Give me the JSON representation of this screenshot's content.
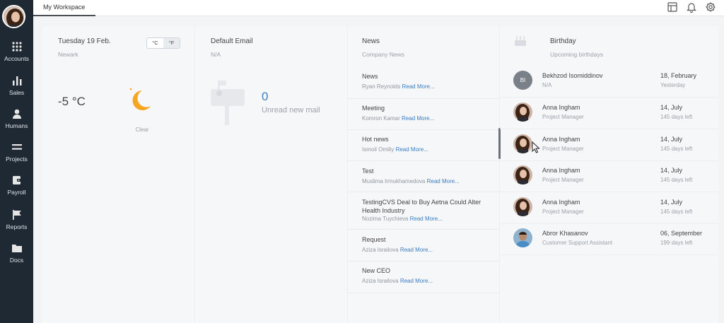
{
  "sidebar": {
    "items": [
      {
        "label": "Accounts",
        "icon": "grid-icon"
      },
      {
        "label": "Sales",
        "icon": "bar-chart-icon"
      },
      {
        "label": "Humans",
        "icon": "person-icon"
      },
      {
        "label": "Projects",
        "icon": "list-icon"
      },
      {
        "label": "Payroll",
        "icon": "wallet-icon"
      },
      {
        "label": "Reports",
        "icon": "flag-icon"
      },
      {
        "label": "Docs",
        "icon": "folder-icon"
      }
    ]
  },
  "topbar": {
    "tab_label": "My Workspace",
    "icons": [
      "layout-icon",
      "bell-icon",
      "gear-icon"
    ]
  },
  "weather": {
    "date": "Tuesday 19 Feb.",
    "city": "Newark",
    "unit_c": "°C",
    "unit_f": "°F",
    "temperature": "-5 °C",
    "condition": "Clear",
    "icon": "moon-icon"
  },
  "email": {
    "title": "Default Email",
    "address": "N/A",
    "unread_count": "0",
    "unread_label": "Unread new mail",
    "icon": "mailbox-icon"
  },
  "news": {
    "title": "News",
    "subtitle": "Company News",
    "read_more": "Read More...",
    "items": [
      {
        "title": "News",
        "author": "Ryan Reynolds"
      },
      {
        "title": "Meeting",
        "author": "Komron Kamar"
      },
      {
        "title": "Hot news",
        "author": "Ismoil Omiliy"
      },
      {
        "title": "Test",
        "author": "Muslima Irmukhamedova"
      },
      {
        "title": "TestingCVS Deal to Buy Aetna Could Alter Health Industry",
        "author": "Nozima Tuychieva"
      },
      {
        "title": "Request",
        "author": "Aziza Israilova"
      },
      {
        "title": "New CEO",
        "author": "Aziza Israilova"
      }
    ]
  },
  "birthday": {
    "title": "Birthday",
    "subtitle": "Upcoming birthdays",
    "icon": "cake-icon",
    "items": [
      {
        "initials": "BI",
        "name": "Bekhzod Isomiddinov",
        "role": "N/A",
        "date": "18, February",
        "left": "Yesterday"
      },
      {
        "initials": "",
        "name": "Anna Ingham",
        "role": "Project Manager",
        "date": "14, July",
        "left": "145 days left"
      },
      {
        "initials": "",
        "name": "Anna Ingham",
        "role": "Project Manager",
        "date": "14, July",
        "left": "145 days left"
      },
      {
        "initials": "",
        "name": "Anna Ingham",
        "role": "Project Manager",
        "date": "14, July",
        "left": "145 days left"
      },
      {
        "initials": "",
        "name": "Anna Ingham",
        "role": "Project Manager",
        "date": "14, July",
        "left": "145 days left"
      },
      {
        "initials": "",
        "name": "Abror Khasanov",
        "role": "Customer Support Assistant",
        "date": "06, September",
        "left": "199 days left"
      }
    ]
  },
  "colors": {
    "sidebar_bg": "#1f2933",
    "accent_link": "#3a7cc0",
    "sun": "#f5a623"
  }
}
